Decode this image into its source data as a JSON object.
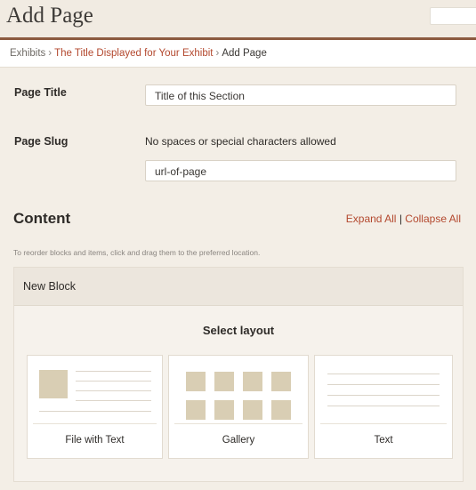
{
  "header": {
    "title": "Add Page"
  },
  "breadcrumb": {
    "items": [
      "Exhibits",
      "The Title Displayed for Your Exhibit",
      "Add Page"
    ],
    "separator": "›"
  },
  "form": {
    "page_title_label": "Page Title",
    "page_title_value": "Title of this Section",
    "page_slug_label": "Page Slug",
    "slug_hint": "No spaces or special characters allowed",
    "slug_value": "url-of-page"
  },
  "content": {
    "title": "Content",
    "expand_all": "Expand All",
    "divider": "|",
    "collapse_all": "Collapse All",
    "reorder_hint": "To reorder blocks and items, click and drag them to the preferred location."
  },
  "block": {
    "name": "New Block",
    "select_layout": "Select layout",
    "layouts": [
      {
        "label": "File with Text",
        "icon": "file-with-text-icon"
      },
      {
        "label": "Gallery",
        "icon": "gallery-icon"
      },
      {
        "label": "Text",
        "icon": "text-icon"
      }
    ]
  },
  "colors": {
    "accent": "#b3482e",
    "header_rule": "#8c5a40",
    "placeholder_beige": "#d9ceb4"
  }
}
